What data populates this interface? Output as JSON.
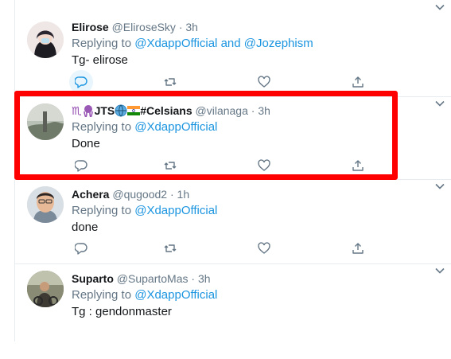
{
  "tweets": [
    {
      "name": "Elirose",
      "handle": "@EliroseSky",
      "sep": "·",
      "time": "3h",
      "replying_prefix": "Replying to ",
      "mention1": "@XdappOfficial",
      "and_word": " and ",
      "mention2": "@Jozephism",
      "text": "Tg- elirose"
    },
    {
      "name_prefix": "♏",
      "name_mid": "JTS",
      "name_suffix": "#Celsians",
      "handle": "@vilanaga",
      "sep": "·",
      "time": "3h",
      "replying_prefix": "Replying to ",
      "mention1": "@XdappOfficial",
      "text": "Done"
    },
    {
      "name": "Achera",
      "handle": "@qugood2",
      "sep": "·",
      "time": "1h",
      "replying_prefix": "Replying to ",
      "mention1": "@XdappOfficial",
      "text": "done"
    },
    {
      "name": "Suparto",
      "handle": "@SupartoMas",
      "sep": "·",
      "time": "3h",
      "replying_prefix": "Replying to ",
      "mention1": "@XdappOfficial",
      "text": "Tg : gendonmaster"
    }
  ],
  "icons": [
    "reply-icon",
    "retweet-icon",
    "like-icon",
    "share-icon",
    "chevron-down-icon"
  ],
  "colors": {
    "link": "#1b95e0",
    "secondary_text": "#657786",
    "primary_text": "#14171a",
    "highlight_box": "#ff0000"
  }
}
